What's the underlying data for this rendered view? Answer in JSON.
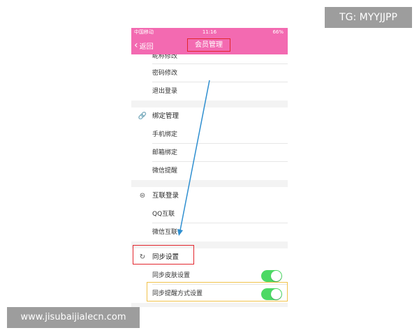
{
  "watermark_top": "TG: MYYJJPP",
  "watermark_bottom": "www.jisubaijialecn.com",
  "status": {
    "carrier": "中国移动",
    "time": "11:16",
    "battery": "66%"
  },
  "nav": {
    "back_label": "返回",
    "title": "会员管理"
  },
  "account_items": [
    "昵称修改",
    "密码修改",
    "退出登录"
  ],
  "bind": {
    "header": "绑定管理",
    "items": [
      "手机绑定",
      "邮箱绑定",
      "微信提醒"
    ]
  },
  "connect": {
    "header": "互联登录",
    "items": [
      "QQ互联",
      "微信互联"
    ]
  },
  "sync": {
    "header": "同步设置",
    "items": [
      "同步皮肤设置",
      "同步提醒方式设置"
    ]
  },
  "colors": {
    "navbar": "#f36ab1",
    "toggle_on": "#4cd964",
    "highlight_red": "#e3262d",
    "highlight_yellow": "#f1c24b",
    "arrow": "#2f8fd0"
  }
}
